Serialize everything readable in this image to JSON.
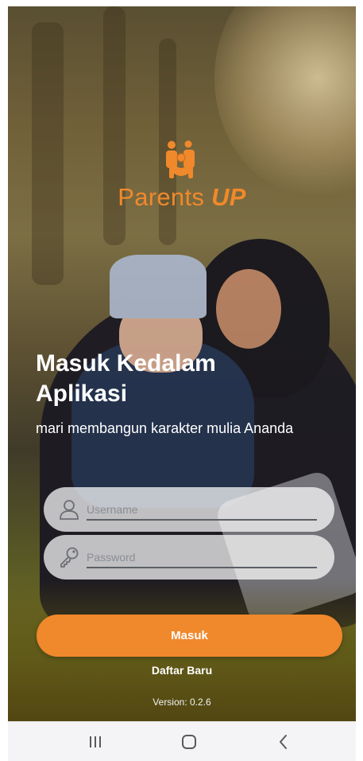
{
  "app": {
    "brand_primary": "Parents",
    "brand_accent": "UP",
    "brand_color": "#f0892b"
  },
  "login": {
    "title": "Masuk Kedalam Aplikasi",
    "subtitle": "mari membangun karakter mulia Ananda",
    "username_placeholder": "Username",
    "password_placeholder": "Password",
    "submit_label": "Masuk",
    "register_label": "Daftar Baru",
    "version": "Version: 0.2.6"
  },
  "icons": {
    "logo": "family-icon",
    "username": "user-icon",
    "password": "key-icon",
    "nav_recent": "recent-apps-icon",
    "nav_home": "home-icon",
    "nav_back": "back-icon"
  },
  "colors": {
    "accent": "#f0882c",
    "field_bg": "rgba(255,255,255,0.72)",
    "navbar_bg": "#f4f4f6"
  }
}
